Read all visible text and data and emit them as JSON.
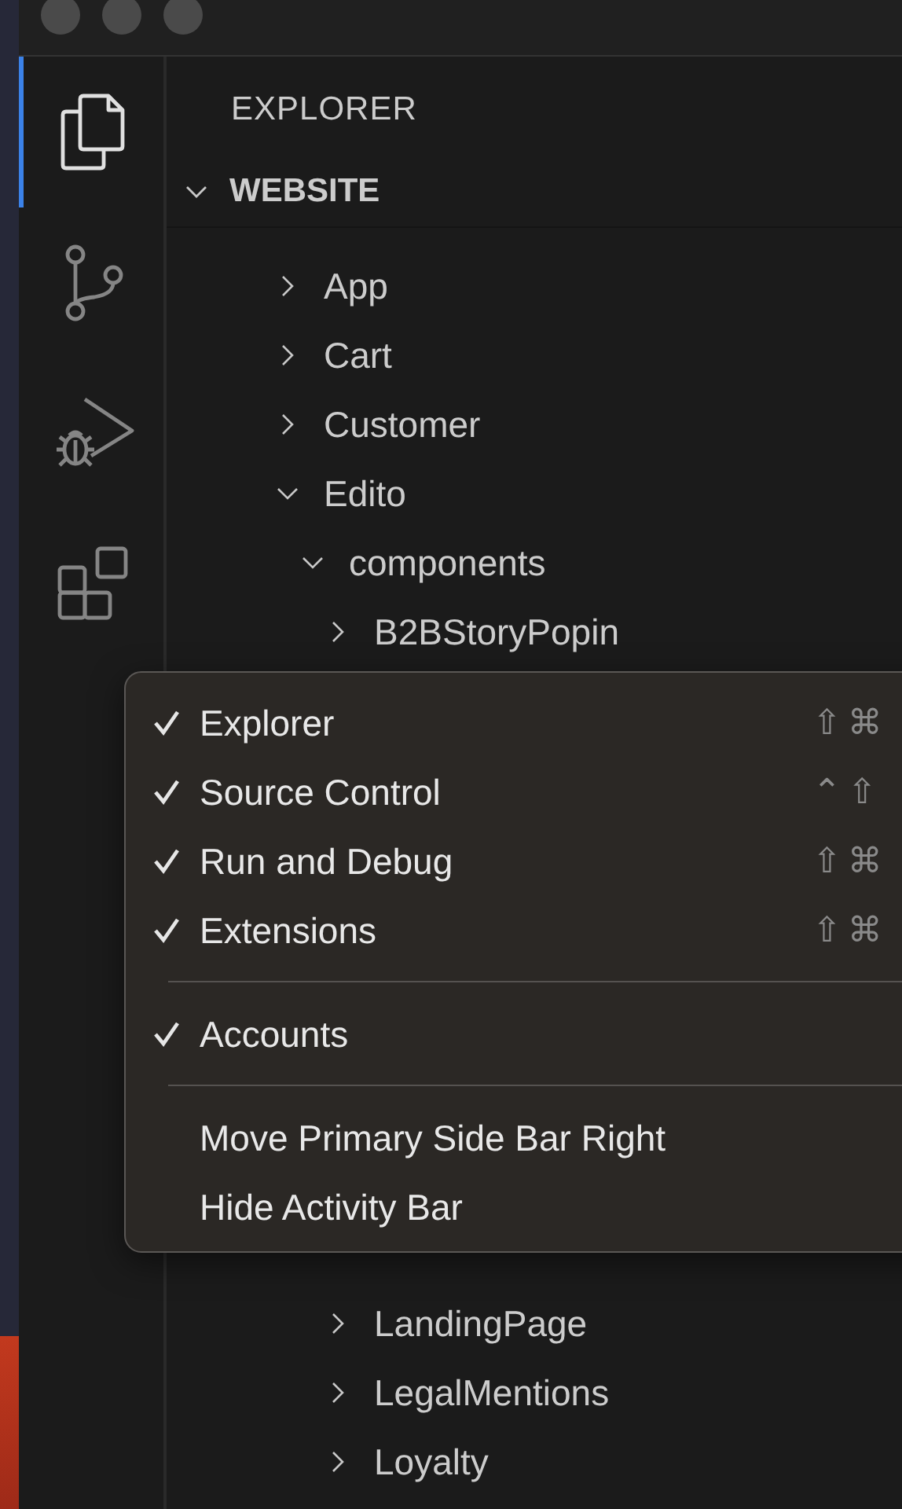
{
  "activity_bar": {
    "items": [
      {
        "kind": "files",
        "selected": true
      },
      {
        "kind": "branches",
        "selected": false
      },
      {
        "kind": "debug",
        "selected": false
      },
      {
        "kind": "blocks",
        "selected": false
      }
    ]
  },
  "sidebar": {
    "title": "EXPLORER",
    "section": {
      "label": "WEBSITE",
      "expanded": true
    },
    "tree": [
      {
        "label": "App",
        "expanded": false
      },
      {
        "label": "Cart",
        "expanded": false
      },
      {
        "label": "Customer",
        "expanded": false
      },
      {
        "label": "Edito",
        "expanded": true,
        "children": [
          {
            "label": "components",
            "expanded": true,
            "children": [
              {
                "label": "B2BStoryPopin",
                "expanded": false
              },
              {
                "label": "LandingPage",
                "expanded": false
              },
              {
                "label": "LegalMentions",
                "expanded": false
              },
              {
                "label": "Loyalty",
                "expanded": false
              }
            ]
          }
        ]
      }
    ]
  },
  "context_menu": {
    "groups": [
      [
        {
          "label": "Explorer",
          "checked": true,
          "shortcut": "⇧⌘"
        },
        {
          "label": "Source Control",
          "checked": true,
          "shortcut": "⌃⇧"
        },
        {
          "label": "Run and Debug",
          "checked": true,
          "shortcut": "⇧⌘"
        },
        {
          "label": "Extensions",
          "checked": true,
          "shortcut": "⇧⌘"
        }
      ],
      [
        {
          "label": "Accounts",
          "checked": true
        }
      ],
      [
        {
          "label": "Move Primary Side Bar Right",
          "checked": false
        },
        {
          "label": "Hide Activity Bar",
          "checked": false
        }
      ]
    ]
  }
}
